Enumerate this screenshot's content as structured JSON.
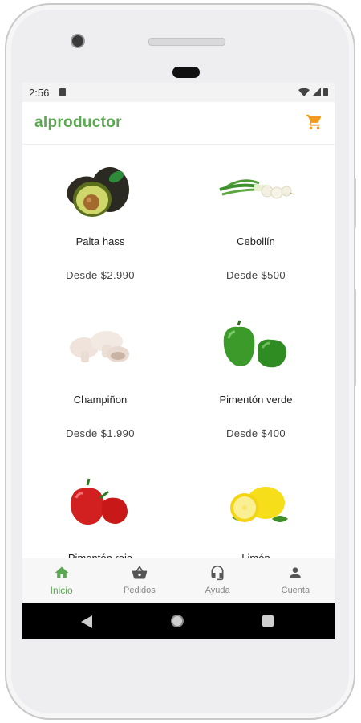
{
  "status_bar": {
    "time": "2:56"
  },
  "app": {
    "title": "alproductor",
    "cart_icon": "cart-icon"
  },
  "products": [
    {
      "name": "Palta hass",
      "price": "Desde $2.990"
    },
    {
      "name": "Cebollín",
      "price": "Desde $500"
    },
    {
      "name": "Champiñon",
      "price": "Desde $1.990"
    },
    {
      "name": "Pimentón verde",
      "price": "Desde $400"
    },
    {
      "name": "Pimentón rojo",
      "price": ""
    },
    {
      "name": "Limón",
      "price": ""
    }
  ],
  "bottom_nav": [
    {
      "label": "Inicio",
      "icon": "home-icon",
      "active": true
    },
    {
      "label": "Pedidos",
      "icon": "basket-icon",
      "active": false
    },
    {
      "label": "Ayuda",
      "icon": "headset-icon",
      "active": false
    },
    {
      "label": "Cuenta",
      "icon": "person-icon",
      "active": false
    }
  ],
  "colors": {
    "brand_green": "#5aa84f",
    "cart_orange": "#f39a1e"
  }
}
